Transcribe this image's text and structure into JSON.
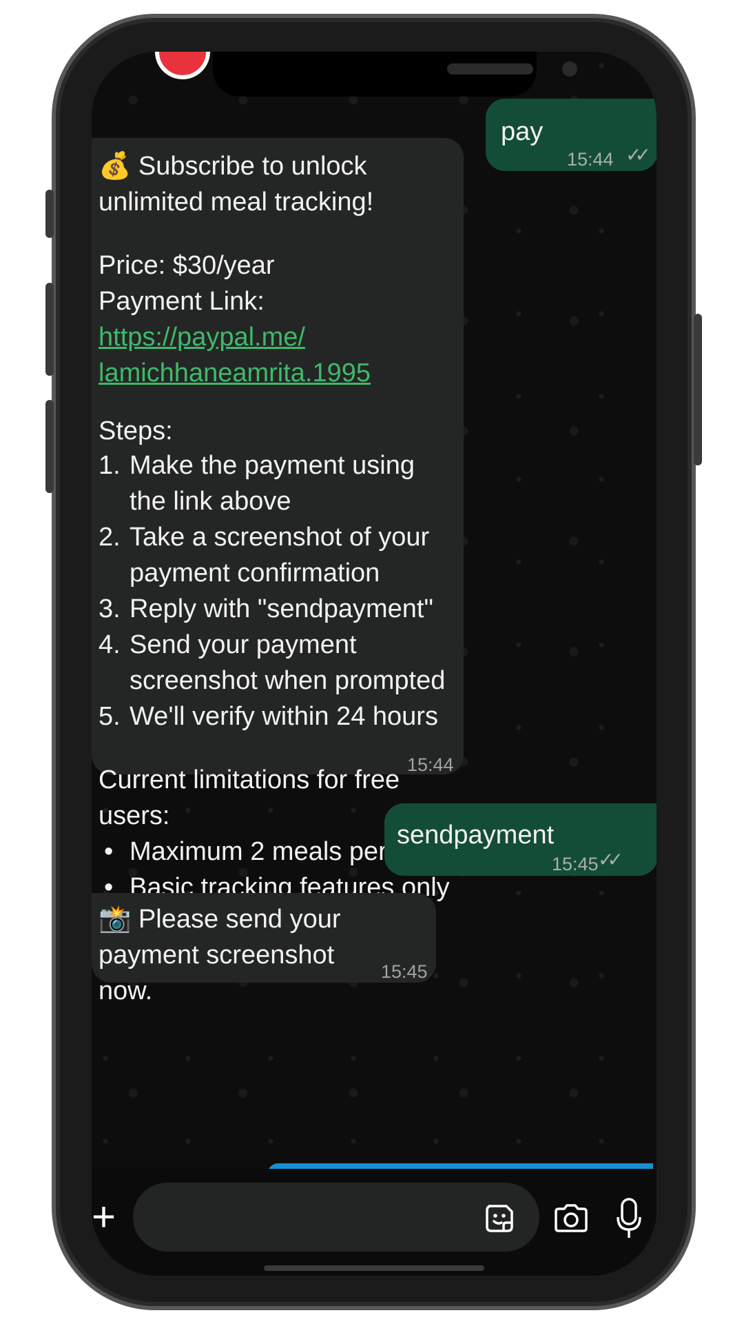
{
  "messages": {
    "m1": {
      "text": "pay",
      "time": "15:44",
      "status": "✓✓"
    },
    "m2": {
      "emoji": "💰",
      "intro": "Subscribe to unlock unlimited meal tracking!",
      "price": "Price: $30/year",
      "link_label": "Payment Link: ",
      "link_line1": "https://paypal.me/",
      "link_line2": "lamichhaneamrita.1995",
      "steps_title": "Steps:",
      "steps": [
        {
          "n": "1.",
          "text": "Make the payment using the link above"
        },
        {
          "n": "2.",
          "text": "Take a screenshot of your payment confirmation"
        },
        {
          "n": "3.",
          "text": "Reply with \"sendpayment\""
        },
        {
          "n": "4.",
          "text": "Send your payment screenshot when prompted"
        },
        {
          "n": "5.",
          "text": "We'll verify within 24 hours"
        }
      ],
      "limits_title": "Current limitations for free users:",
      "limits": [
        "Maximum 2 meals per day",
        "Basic tracking features only"
      ],
      "time": "15:44"
    },
    "m3": {
      "text": "sendpayment",
      "time": "15:45",
      "status": "✓✓"
    },
    "m4": {
      "emoji": "📸",
      "text": "Please send your payment screenshot now.",
      "time": "15:45"
    }
  },
  "composer": {
    "plus": "+",
    "sticker_icon": "sticker-icon",
    "camera_icon": "camera-icon",
    "mic_icon": "mic-icon"
  },
  "colors": {
    "outgoing_bubble": "#144d37",
    "incoming_bubble": "#242626",
    "link": "#3fb96a"
  }
}
